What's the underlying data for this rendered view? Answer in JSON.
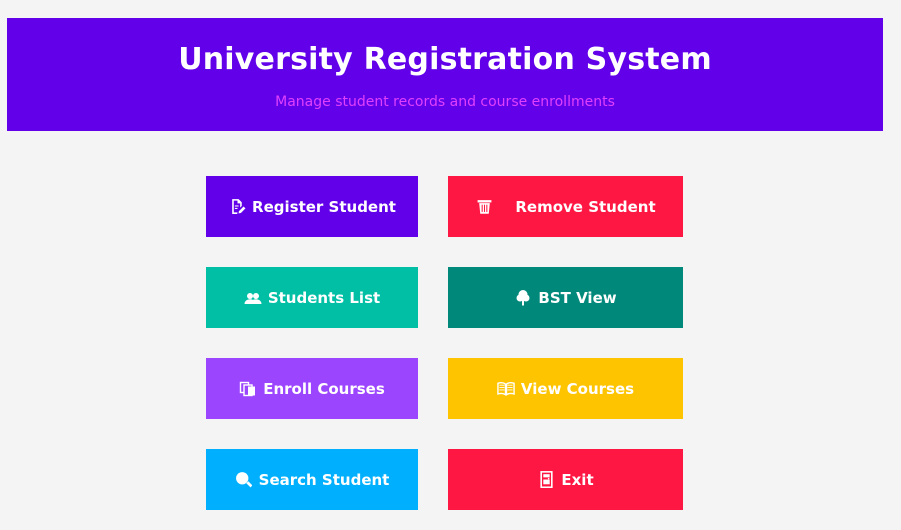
{
  "header": {
    "title": "University Registration System",
    "subtitle": "Manage student records and course enrollments"
  },
  "buttons": {
    "register": {
      "label": "Register Student",
      "icon": "edit-document-icon",
      "color": "#6200ea"
    },
    "remove": {
      "label": "Remove Student",
      "icon": "trash-icon",
      "color": "#ff1744"
    },
    "list": {
      "label": "Students List",
      "icon": "users-icon",
      "color": "#00bfa5"
    },
    "bst": {
      "label": "BST View",
      "icon": "tree-icon",
      "color": "#00897b"
    },
    "enroll": {
      "label": "Enroll Courses",
      "icon": "copy-documents-icon",
      "color": "#9c45ff"
    },
    "view": {
      "label": "View Courses",
      "icon": "open-book-icon",
      "color": "#ffc400"
    },
    "search": {
      "label": "Search Student",
      "icon": "search-icon",
      "color": "#00b0ff"
    },
    "exit": {
      "label": "Exit",
      "icon": "door-icon",
      "color": "#ff1744"
    }
  },
  "colors": {
    "header_bg": "#6200ea",
    "subtitle": "#e040fb",
    "page_bg": "#f4f4f4"
  }
}
